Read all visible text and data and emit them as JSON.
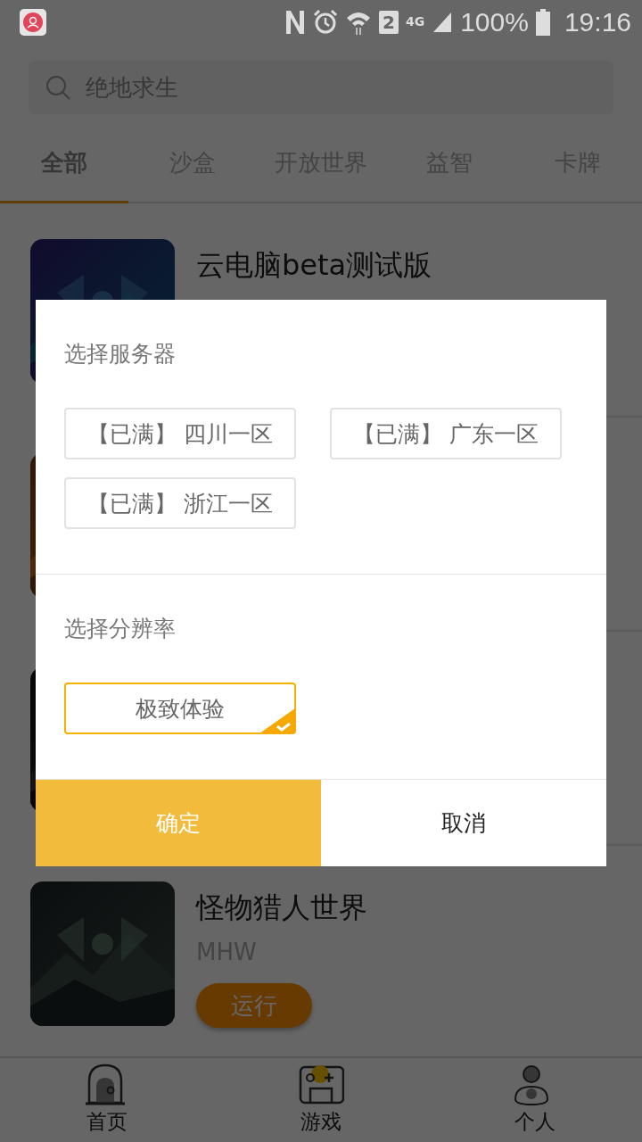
{
  "status_bar": {
    "network": "4G",
    "sim": "2",
    "battery": "100%",
    "time": "19:16"
  },
  "search": {
    "placeholder": "绝地求生"
  },
  "tabs": [
    {
      "label": "全部",
      "selected": true
    },
    {
      "label": "沙盒",
      "selected": false
    },
    {
      "label": "开放世界",
      "selected": false
    },
    {
      "label": "益智",
      "selected": false
    },
    {
      "label": "卡牌",
      "selected": false
    }
  ],
  "games": [
    {
      "kind": "picture",
      "title": "云电脑beta测试版"
    },
    {
      "kind": "picture"
    },
    {
      "kind": "picture"
    },
    {
      "kind": "picture",
      "title": "怪物猎人世界",
      "subtitle": "MHW",
      "button": "运行"
    }
  ],
  "dialog": {
    "sections": [
      {
        "title": "选择服务器",
        "options": [
          {
            "label": "【已满】 四川一区",
            "selected": false
          },
          {
            "label": "【已满】 广东一区",
            "selected": false
          },
          {
            "label": "【已满】 浙江一区",
            "selected": false
          }
        ]
      },
      {
        "title": "选择分辨率",
        "options": [
          {
            "label": "极致体验",
            "selected": true
          }
        ]
      }
    ],
    "buttons": [
      {
        "label": "确定",
        "kind": "primary"
      },
      {
        "label": "取消",
        "kind": "secondary"
      }
    ]
  },
  "bottom_nav": [
    {
      "label": "首页",
      "kind": "home",
      "selected": false
    },
    {
      "label": "游戏",
      "kind": "games",
      "selected": true
    },
    {
      "label": "个人",
      "kind": "profile",
      "selected": false
    }
  ]
}
